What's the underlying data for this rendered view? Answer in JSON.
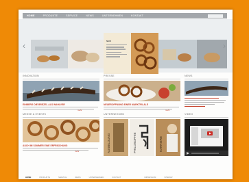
{
  "nav": {
    "items": [
      "HOME",
      "PRODUKTE",
      "SERVICE",
      "NEWS",
      "UNTERNEHMEN",
      "KONTAKT"
    ]
  },
  "slider": {
    "caption_title": "NEW"
  },
  "sections": {
    "innovation": "INNOVATION",
    "presse": "PRESSE",
    "news": "NEWS",
    "messe": "MESSE & EVENTS",
    "unternehmen": "UNTERNEHMEN",
    "video": "VIDEO"
  },
  "articles": {
    "innovation_caption": "EINBERG DIE BREZEL ALS WAHLVER",
    "presse_caption": "NEUEROFFNUNG EINER MARKTFILALE",
    "messe_caption": "AUCH IM SOMMER EINE ERFRISCHUNG",
    "more": "mehr"
  },
  "unternehmen_labels": [
    "AUSBILDUNG",
    "PHILOSOPHIE",
    "KARRIERE"
  ],
  "footer": {
    "items": [
      "HOME",
      "PRODUKTE",
      "SERVICE",
      "NEWS",
      "UNTERNEHMEN",
      "KONTAKT",
      "IMPRESSUM",
      "SITEMAP"
    ]
  },
  "colors": {
    "background": "#ef8a06",
    "caption_red": "#c7412a",
    "nav_grey": "#a3a7ab"
  }
}
